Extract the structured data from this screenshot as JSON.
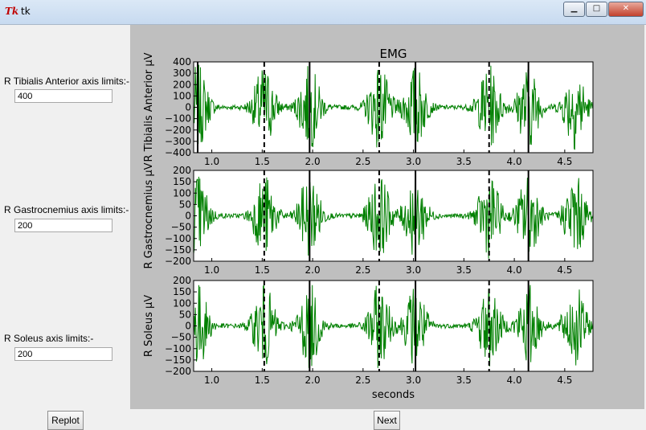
{
  "window": {
    "logo": "Tk",
    "title": "tk",
    "min_glyph": "▁",
    "max_glyph": "□",
    "close_glyph": "✕"
  },
  "controls": {
    "ta_label": "R Tibialis Anterior axis limits:-",
    "ta_value": "400",
    "gas_label": "R Gastrocnemius axis limits:-",
    "gas_value": "200",
    "sol_label": "R Soleus axis limits:-",
    "sol_value": "200",
    "replot_label": "Replot",
    "next_label": "Next"
  },
  "colors": {
    "signal": "#008000",
    "figure_bg": "#bfbfbf",
    "axes_bg": "#ffffff"
  },
  "chart_data": [
    {
      "type": "line",
      "title": "EMG",
      "ylabel": "R Tibialis Anterior µV",
      "xlabel": "",
      "xlim": [
        0.82,
        4.78
      ],
      "ylim": [
        -400,
        400
      ],
      "xticks": [
        1.0,
        1.5,
        2.0,
        2.5,
        3.0,
        3.5,
        4.0,
        4.5
      ],
      "xtick_labels": [
        "1.0",
        "1.5",
        "2.0",
        "2.5",
        "3.0",
        "3.5",
        "4.0",
        "4.5"
      ],
      "yticks": [
        400,
        300,
        200,
        100,
        0,
        -100,
        -200,
        -300,
        -400
      ],
      "ytick_labels": [
        "400",
        "300",
        "200",
        "100",
        "0",
        "−100",
        "−200",
        "−300",
        "−400"
      ],
      "solid_markers_x": [
        0.86,
        1.97,
        3.02,
        4.14
      ],
      "dashed_markers_x": [
        1.52,
        2.66,
        3.75
      ],
      "series_color": "#008000"
    },
    {
      "type": "line",
      "title": "",
      "ylabel": "R Gastrocnemius µV",
      "xlabel": "",
      "xlim": [
        0.82,
        4.78
      ],
      "ylim": [
        -200,
        200
      ],
      "xticks": [
        1.0,
        1.5,
        2.0,
        2.5,
        3.0,
        3.5,
        4.0,
        4.5
      ],
      "xtick_labels": [
        "1.0",
        "1.5",
        "2.0",
        "2.5",
        "3.0",
        "3.5",
        "4.0",
        "4.5"
      ],
      "yticks": [
        200,
        150,
        100,
        50,
        0,
        -50,
        -100,
        -150,
        -200
      ],
      "ytick_labels": [
        "200",
        "150",
        "100",
        "50",
        "0",
        "−50",
        "−100",
        "−150",
        "−200"
      ],
      "solid_markers_x": [
        1.97,
        3.02,
        4.14
      ],
      "dashed_markers_x": [
        1.52,
        2.66,
        3.75
      ],
      "series_color": "#008000"
    },
    {
      "type": "line",
      "title": "",
      "ylabel": "R Soleus µV",
      "xlabel": "seconds",
      "xlim": [
        0.82,
        4.78
      ],
      "ylim": [
        -200,
        200
      ],
      "xticks": [
        1.0,
        1.5,
        2.0,
        2.5,
        3.0,
        3.5,
        4.0,
        4.5
      ],
      "xtick_labels": [
        "1.0",
        "1.5",
        "2.0",
        "2.5",
        "3.0",
        "3.5",
        "4.0",
        "4.5"
      ],
      "yticks": [
        200,
        150,
        100,
        50,
        0,
        -50,
        -100,
        -150,
        -200
      ],
      "ytick_labels": [
        "200",
        "150",
        "100",
        "50",
        "0",
        "−50",
        "−100",
        "−150",
        "−200"
      ],
      "solid_markers_x": [
        1.97,
        3.02,
        4.14
      ],
      "dashed_markers_x": [
        1.52,
        2.66,
        3.75
      ],
      "series_color": "#008000"
    }
  ]
}
